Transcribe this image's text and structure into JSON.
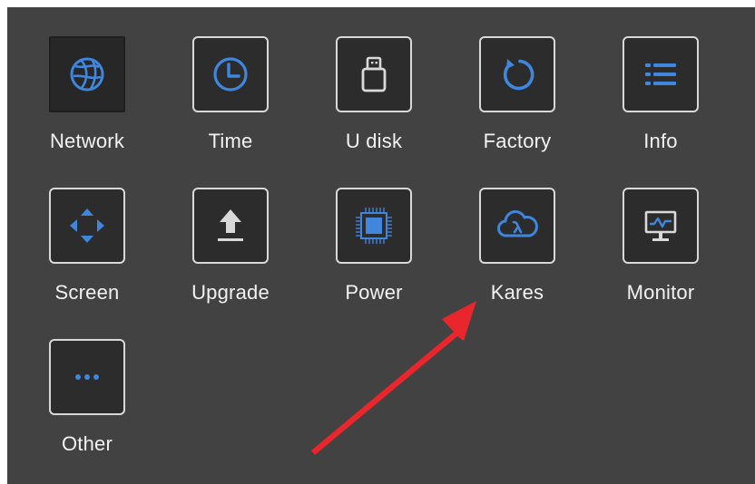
{
  "menu": {
    "items": [
      {
        "label": "Network",
        "icon": "globe-icon",
        "selected": true
      },
      {
        "label": "Time",
        "icon": "clock-icon"
      },
      {
        "label": "U disk",
        "icon": "usb-drive-icon"
      },
      {
        "label": "Factory",
        "icon": "reset-icon"
      },
      {
        "label": "Info",
        "icon": "list-icon"
      },
      {
        "label": "Screen",
        "icon": "move-arrows-icon"
      },
      {
        "label": "Upgrade",
        "icon": "upload-icon"
      },
      {
        "label": "Power",
        "icon": "chip-icon"
      },
      {
        "label": "Kares",
        "icon": "cloud-lambda-icon"
      },
      {
        "label": "Monitor",
        "icon": "monitor-icon"
      },
      {
        "label": "Other",
        "icon": "more-icon"
      }
    ]
  },
  "colors": {
    "background": "#424242",
    "icon_accent": "#3f86dc",
    "tile_border": "#d9d9d9",
    "annotation_arrow": "#e8262c"
  }
}
